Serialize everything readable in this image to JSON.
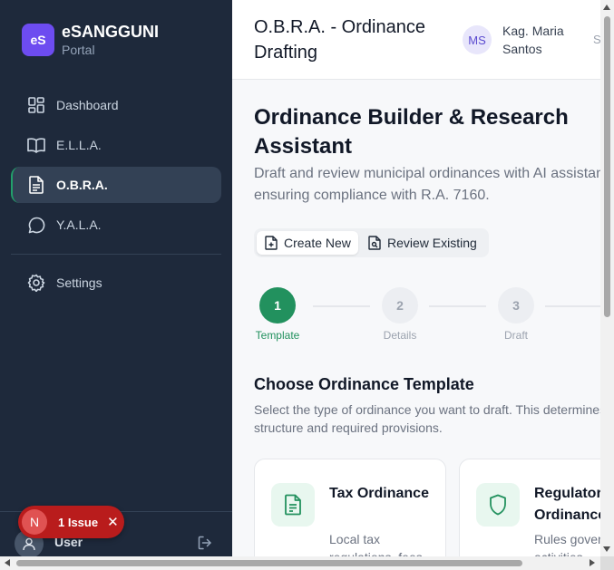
{
  "brand": {
    "logo": "eS",
    "title": "eSANGGUNI",
    "subtitle": "Portal"
  },
  "sidebar": {
    "items": [
      {
        "label": "Dashboard",
        "icon": "dashboard-icon",
        "active": false
      },
      {
        "label": "E.L.L.A.",
        "icon": "book-icon",
        "active": false
      },
      {
        "label": "O.B.R.A.",
        "icon": "document-icon",
        "active": true
      },
      {
        "label": "Y.A.L.A.",
        "icon": "chat-bubble-icon",
        "active": false
      }
    ],
    "settings": {
      "label": "Settings",
      "icon": "gear-icon"
    },
    "user": {
      "label": "User",
      "icon": "user-icon"
    },
    "logout_icon": "logout-icon"
  },
  "issue_badge": {
    "initial": "N",
    "label": "1 Issue",
    "close": "✕"
  },
  "header": {
    "title": "O.B.R.A. - Ordinance Drafting",
    "avatar_initials": "MS",
    "user_name": "Kag. Maria Santos",
    "truncated": "S"
  },
  "main": {
    "title": "Ordinance Builder & Research Assistant",
    "description": "Draft and review municipal ordinances with AI assistance, ensuring compliance with R.A. 7160.",
    "mode_toggle": [
      {
        "label": "Create New",
        "icon": "file-plus-icon",
        "active": true
      },
      {
        "label": "Review Existing",
        "icon": "file-search-icon",
        "active": false
      }
    ],
    "steps": [
      {
        "number": "1",
        "label": "Template",
        "state": "current"
      },
      {
        "number": "2",
        "label": "Details",
        "state": "todo"
      },
      {
        "number": "3",
        "label": "Draft",
        "state": "todo"
      }
    ],
    "section": {
      "title": "Choose Ordinance Template",
      "description": "Select the type of ordinance you want to draft. This determines the structure and required provisions."
    },
    "templates": [
      {
        "title": "Tax Ordinance",
        "description": "Local tax regulations, fees",
        "icon": "document-icon"
      },
      {
        "title": "Regulatory Ordinance",
        "description": "Rules governing activities",
        "icon": "shield-icon"
      }
    ]
  },
  "colors": {
    "sidebar_bg": "#1e293b",
    "brand_purple": "#6d4cf0",
    "accent_green": "#22915e",
    "issue_red": "#b91c1c"
  }
}
